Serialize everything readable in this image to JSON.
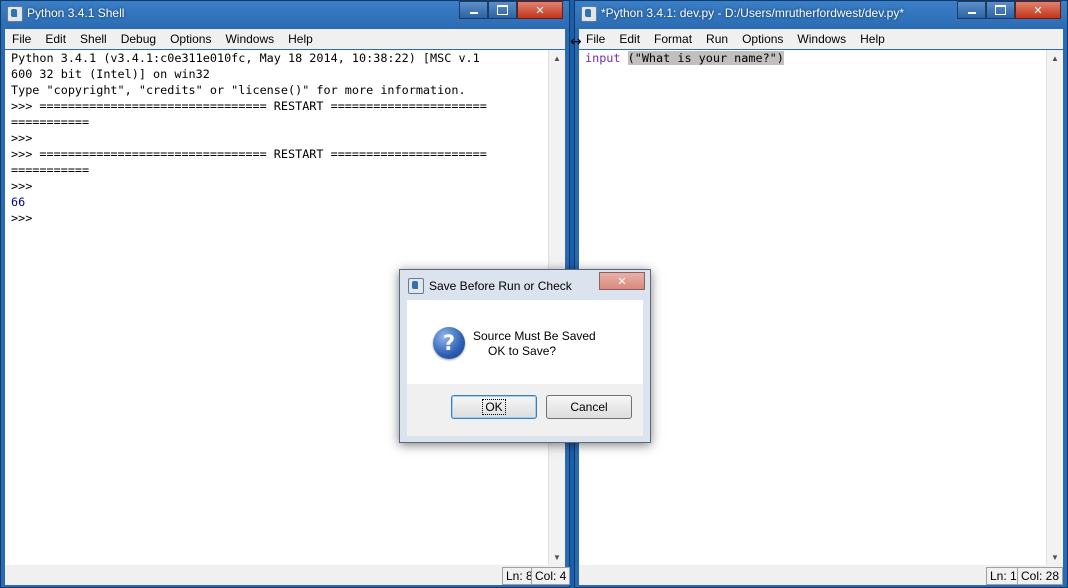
{
  "shell": {
    "title": "Python 3.4.1 Shell",
    "menu": [
      "File",
      "Edit",
      "Shell",
      "Debug",
      "Options",
      "Windows",
      "Help"
    ],
    "lines": [
      "Python 3.4.1 (v3.4.1:c0e311e010fc, May 18 2014, 10:38:22) [MSC v.1",
      "600 32 bit (Intel)] on win32",
      "Type \"copyright\", \"credits\" or \"license()\" for more information.",
      ">>> ================================ RESTART ======================",
      "===========",
      ">>> ",
      ">>> ================================ RESTART ======================",
      "===========",
      ">>> ",
      "66",
      ">>> "
    ],
    "status": {
      "ln": "Ln: 8",
      "col": "Col: 4"
    }
  },
  "editor": {
    "title": "*Python 3.4.1: dev.py - D:/Users/mrutherfordwest/dev.py*",
    "menu": [
      "File",
      "Edit",
      "Format",
      "Run",
      "Options",
      "Windows",
      "Help"
    ],
    "code_keyword": "input",
    "code_space": " ",
    "code_args": "(\"What is your name?\")",
    "status": {
      "ln": "Ln: 1",
      "col": "Col: 28"
    }
  },
  "window_buttons": {
    "minimize": "",
    "maximize": "",
    "close": "✕"
  },
  "dialog": {
    "title": "Save Before Run or Check",
    "close": "✕",
    "icon_glyph": "?",
    "message_line1": "Source Must Be Saved",
    "message_line2": "OK to Save?",
    "ok_label": "OK",
    "cancel_label": "Cancel"
  },
  "cursor_glyph": "↔",
  "scroll_glyphs": {
    "up": "▲",
    "down": "▼"
  }
}
